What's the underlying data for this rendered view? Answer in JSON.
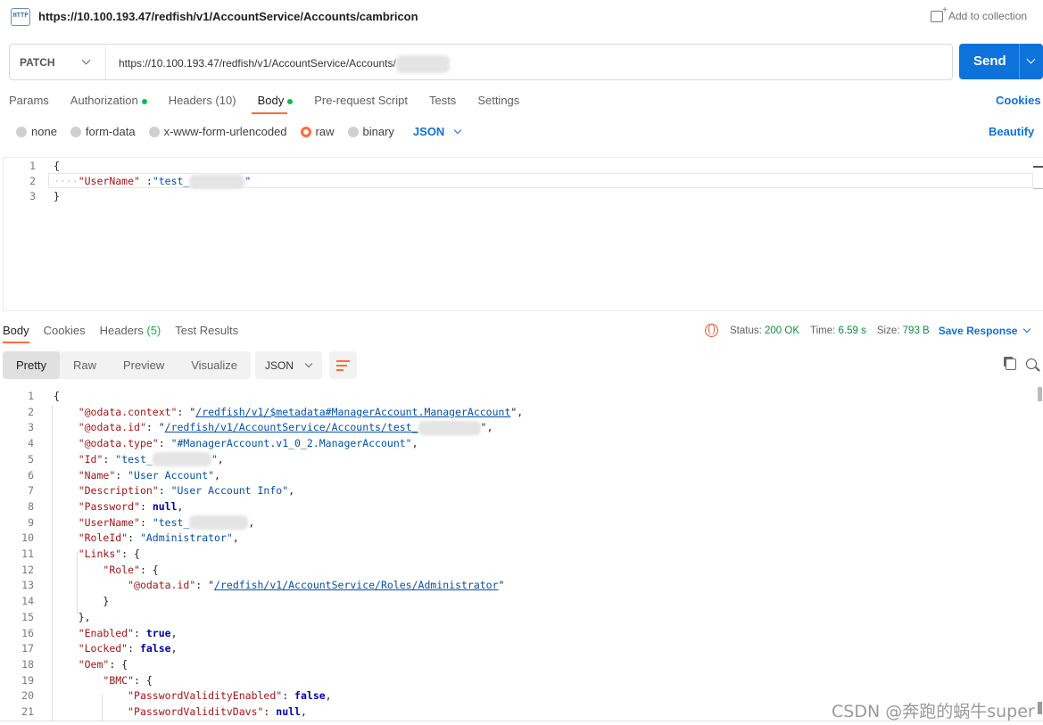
{
  "top": {
    "http_icon": "HTTP",
    "url": "https://10.100.193.47/redfish/v1/AccountService/Accounts/cambricon",
    "add_to_collection": "Add to collection"
  },
  "request": {
    "method": "PATCH",
    "url": "https://10.100.193.47/redfish/v1/AccountService/Accounts/",
    "send_label": "Send"
  },
  "request_tabs": {
    "params": "Params",
    "authorization": "Authorization",
    "headers": "Headers (10)",
    "body": "Body",
    "prerequest": "Pre-request Script",
    "tests": "Tests",
    "settings": "Settings",
    "cookies": "Cookies"
  },
  "body_types": {
    "none": "none",
    "form_data": "form-data",
    "urlencoded": "x-www-form-urlencoded",
    "raw": "raw",
    "binary": "binary",
    "format": "JSON",
    "selected": "raw",
    "beautify": "Beautify"
  },
  "request_body": {
    "line_numbers": [
      "1",
      "2",
      "3"
    ],
    "open_brace": "{",
    "indent_dots": "····",
    "key": "\"UserName\"",
    "sep": " :",
    "value_prefix": "\"test_",
    "value_suffix": "\"",
    "close_brace": "}"
  },
  "response_tabs": {
    "body": "Body",
    "cookies": "Cookies",
    "headers_label": "Headers",
    "headers_count": "(5)",
    "test_results": "Test Results"
  },
  "status": {
    "status_label": "Status:",
    "status_value": "200 OK",
    "time_label": "Time:",
    "time_value": "6.59 s",
    "size_label": "Size:",
    "size_value": "793 B",
    "save_response": "Save Response"
  },
  "view_modes": {
    "pretty": "Pretty",
    "raw": "Raw",
    "preview": "Preview",
    "visualize": "Visualize",
    "format": "JSON",
    "selected": "Pretty"
  },
  "response_body": {
    "l1": "{",
    "l2_key": "\"@odata.context\"",
    "l2_val": "/redfish/v1/$metadata#ManagerAccount.ManagerAccount",
    "l3_key": "\"@odata.id\"",
    "l3_val": "/redfish/v1/AccountService/Accounts/test_",
    "l4_key": "\"@odata.type\"",
    "l4_val": "\"#ManagerAccount.v1_0_2.ManagerAccount\"",
    "l5_key": "\"Id\"",
    "l5_val": "\"test_",
    "l6_key": "\"Name\"",
    "l6_val": "\"User Account\"",
    "l7_key": "\"Description\"",
    "l7_val": "\"User Account Info\"",
    "l8_key": "\"Password\"",
    "l8_val": "null",
    "l9_key": "\"UserName\"",
    "l9_val": "\"test_",
    "l10_key": "\"RoleId\"",
    "l10_val": "\"Administrator\"",
    "l11_key": "\"Links\"",
    "l12_key": "\"Role\"",
    "l13_key": "\"@odata.id\"",
    "l13_val": "/redfish/v1/AccountService/Roles/Administrator",
    "l16_key": "\"Enabled\"",
    "l16_val": "true",
    "l17_key": "\"Locked\"",
    "l17_val": "false",
    "l18_key": "\"Oem\"",
    "l19_key": "\"BMC\"",
    "l20_key": "\"PasswordValidityEnabled\"",
    "l20_val": "false",
    "l21_key": "\"PasswordValiditvDavs\"",
    "l21_val": "null"
  },
  "watermark": "CSDN @奔跑的蜗牛super"
}
